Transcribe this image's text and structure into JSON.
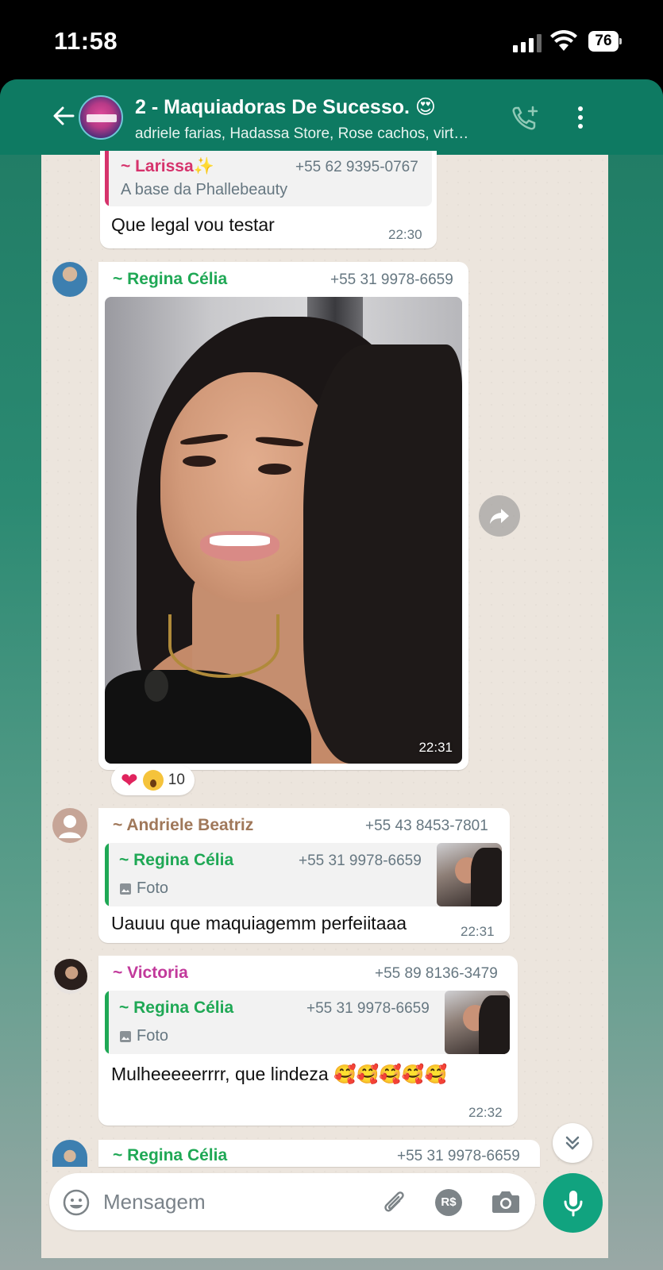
{
  "status_bar": {
    "time": "11:58",
    "battery": "76"
  },
  "header": {
    "title": "2 - Maquiadoras De Sucesso. 😍",
    "subtitle": "adriele farias, Hadassa Store, Rose cachos, virt…"
  },
  "messages": [
    {
      "quote": {
        "sender": "~ Larissa✨",
        "phone": "+55 62 9395-0767",
        "text": "A base da Phallebeauty"
      },
      "text": "Que legal vou testar",
      "time": "22:30"
    },
    {
      "sender": "~ Regina Célia",
      "phone": "+55 31 9978-6659",
      "photo_time": "22:31",
      "reactions": {
        "count": "10"
      }
    },
    {
      "sender": "~ Andriele Beatriz",
      "phone": "+55 43 8453-7801",
      "quote": {
        "sender": "~ Regina Célia",
        "phone": "+55 31 9978-6659",
        "text": "Foto"
      },
      "text": "Uauuu que maquiagemm perfeiitaaa",
      "time": "22:31"
    },
    {
      "sender": "~ Victoria",
      "phone": "+55 89 8136-3479",
      "quote": {
        "sender": "~ Regina Célia",
        "phone": "+55 31 9978-6659",
        "text": "Foto"
      },
      "text": "Mulheeeeerrrr, que lindeza 🥰🥰🥰🥰🥰",
      "time": "22:32"
    },
    {
      "sender": "~ Regina Célia",
      "phone": "+55 31 9978-6659"
    }
  ],
  "input": {
    "placeholder": "Mensagem",
    "money_label": "R$"
  },
  "colors": {
    "header_bg": "#0e7a62",
    "chat_bg": "#ece5dd",
    "sender_regina": "#1fa855",
    "sender_larissa": "#d6336c",
    "sender_andriele": "#a0785a",
    "sender_victoria": "#c2399b",
    "mic_bg": "#11a37f"
  },
  "icons": [
    "back-arrow-icon",
    "add-call-icon",
    "more-vert-icon",
    "image-icon",
    "forward-icon",
    "heart-icon",
    "wow-emoji-icon",
    "chevron-double-down-icon",
    "emoji-icon",
    "paperclip-icon",
    "camera-icon",
    "mic-icon",
    "signal-icon",
    "wifi-icon",
    "battery-icon"
  ]
}
